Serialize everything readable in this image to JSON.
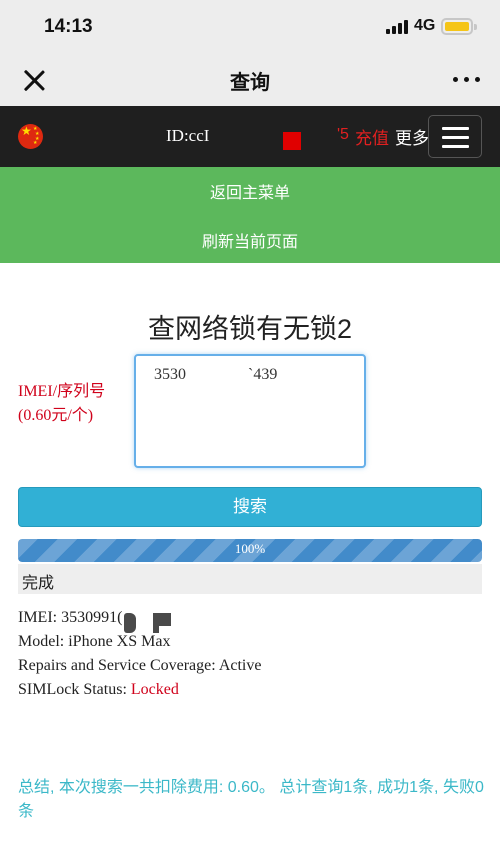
{
  "status_bar": {
    "time": "14:13",
    "network": "4G",
    "battery_color": "#f5c518"
  },
  "nav": {
    "title": "查询",
    "close_icon": "close-icon",
    "more_icon": "more-dots-icon"
  },
  "header": {
    "flag_icon": "china-flag-icon",
    "user_id": "ID:ccI",
    "balance_fragment": "'5",
    "recharge_label": "充值",
    "more_label": "更多",
    "menu_icon": "hamburger-menu-icon"
  },
  "green_menu": {
    "back_label": "返回主菜单",
    "refresh_label": "刷新当前页面"
  },
  "main": {
    "heading": "查网络锁有无锁2",
    "imei_label_line1": "IMEI/序列号",
    "imei_label_line2": "(0.60元/个)",
    "imei_value_part1": "3530",
    "imei_value_part2": "`439",
    "search_label": "搜索",
    "progress_text": "100%",
    "progress_percent": 100,
    "status_text": "完成"
  },
  "result": {
    "imei_label": "IMEI: ",
    "imei_value": "3530991(",
    "model_label": "Model: ",
    "model_value": "iPhone XS Max",
    "repairs_label": "Repairs and Service Coverage: ",
    "repairs_value": "Active",
    "simlock_label": "SIMLock Status: ",
    "simlock_value": "Locked"
  },
  "summary": {
    "text": "总结, 本次搜索一共扣除费用: 0.60。 总计查询1条, 成功1条, 失败0条"
  },
  "colors": {
    "green": "#5cb85c",
    "search": "#31b0d5",
    "progress": "#428bca",
    "alert_red": "#d0021b",
    "summary_cyan": "#3bb8c8"
  }
}
